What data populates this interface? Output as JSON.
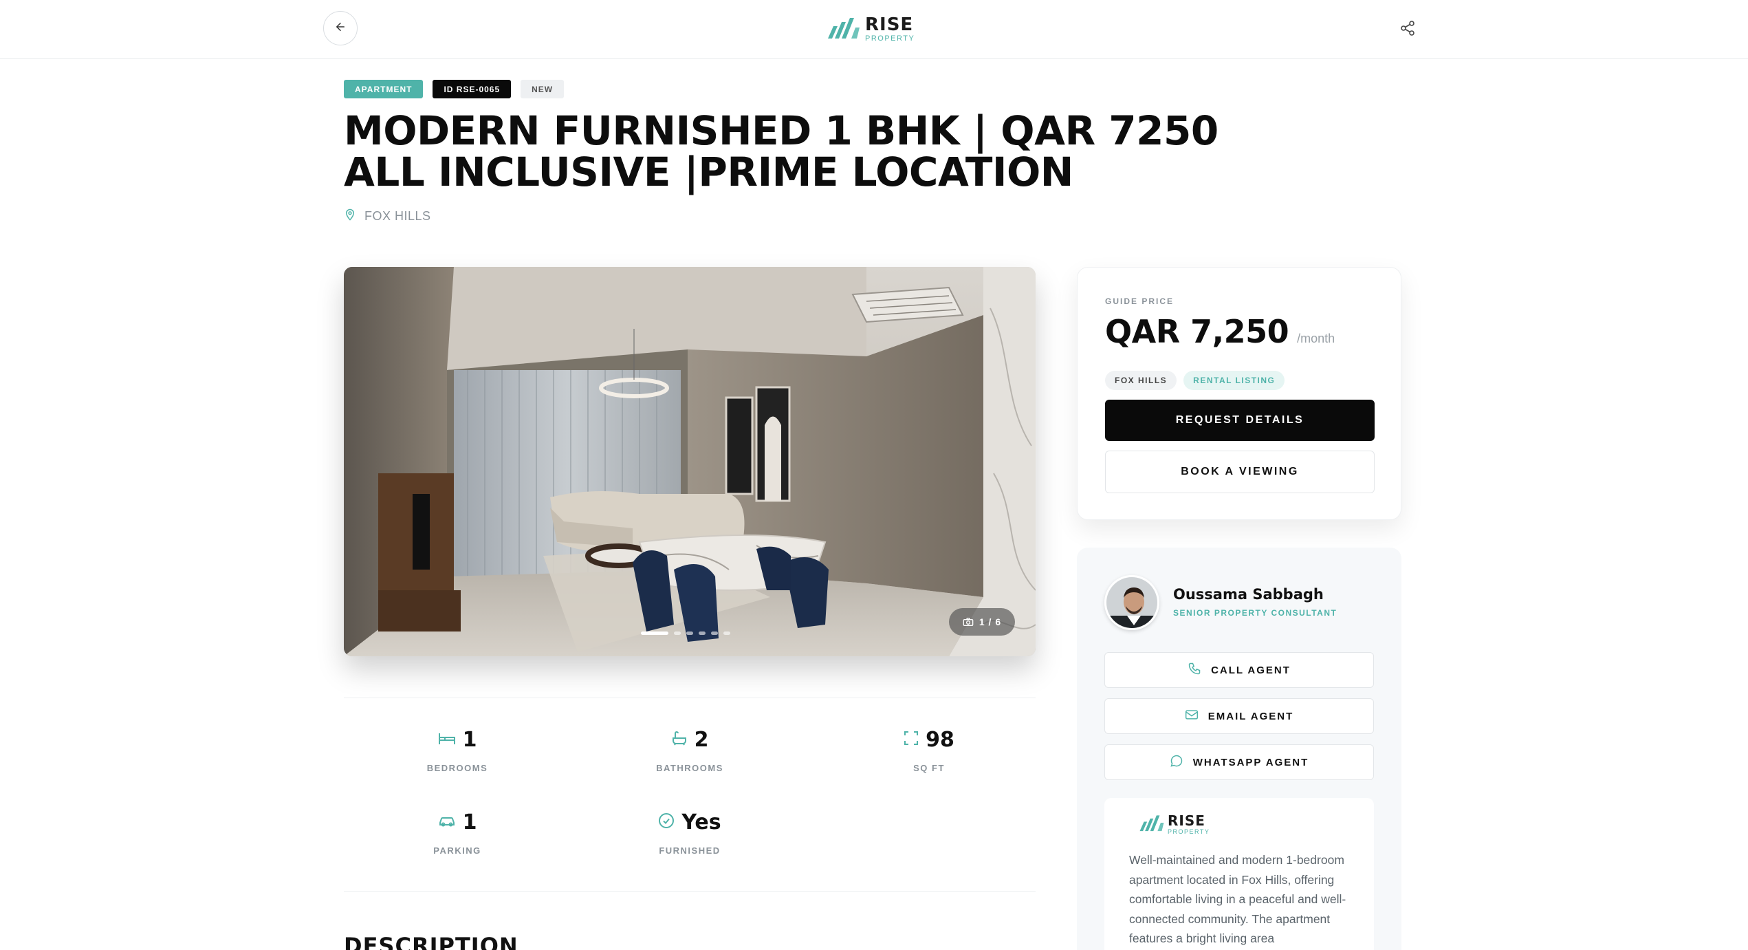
{
  "header": {
    "logo_primary": "RISE",
    "logo_secondary": "PROPERTY"
  },
  "listing": {
    "badges": {
      "type": "APARTMENT",
      "id": "ID RSE-0065",
      "status": "NEW"
    },
    "title": "MODERN FURNISHED 1 BHK | QAR 7250 ALL INCLUSIVE |PRIME LOCATION",
    "location": "FOX HILLS"
  },
  "gallery": {
    "counter": "1 / 6",
    "total_images": 6,
    "active_index": 1
  },
  "stats": [
    {
      "value": "1",
      "label": "BEDROOMS",
      "icon": "bed-icon"
    },
    {
      "value": "2",
      "label": "BATHROOMS",
      "icon": "bath-icon"
    },
    {
      "value": "98",
      "label": "SQ FT",
      "icon": "area-icon"
    },
    {
      "value": "1",
      "label": "PARKING",
      "icon": "car-icon"
    },
    {
      "value": "Yes",
      "label": "FURNISHED",
      "icon": "check-circle-icon"
    }
  ],
  "description": {
    "heading": "DESCRIPTION"
  },
  "price_card": {
    "guide_label": "GUIDE PRICE",
    "price": "QAR 7,250",
    "period": "/month",
    "chips": [
      "FOX HILLS",
      "RENTAL LISTING"
    ],
    "request_label": "REQUEST DETAILS",
    "viewing_label": "BOOK A VIEWING"
  },
  "agent": {
    "name": "Oussama Sabbagh",
    "role": "SENIOR PROPERTY CONSULTANT",
    "call_label": "CALL AGENT",
    "email_label": "EMAIL AGENT",
    "whatsapp_label": "WHATSAPP AGENT",
    "about_logo_primary": "RISE",
    "about_logo_secondary": "PROPERTY",
    "about_text": "Well-maintained and modern 1-bedroom apartment located in Fox Hills, offering comfortable living in a peaceful and well-connected community. The apartment features a bright living area"
  },
  "colors": {
    "accent": "#4fb3a9",
    "dark": "#0a0a0a",
    "muted": "#8a9299"
  }
}
